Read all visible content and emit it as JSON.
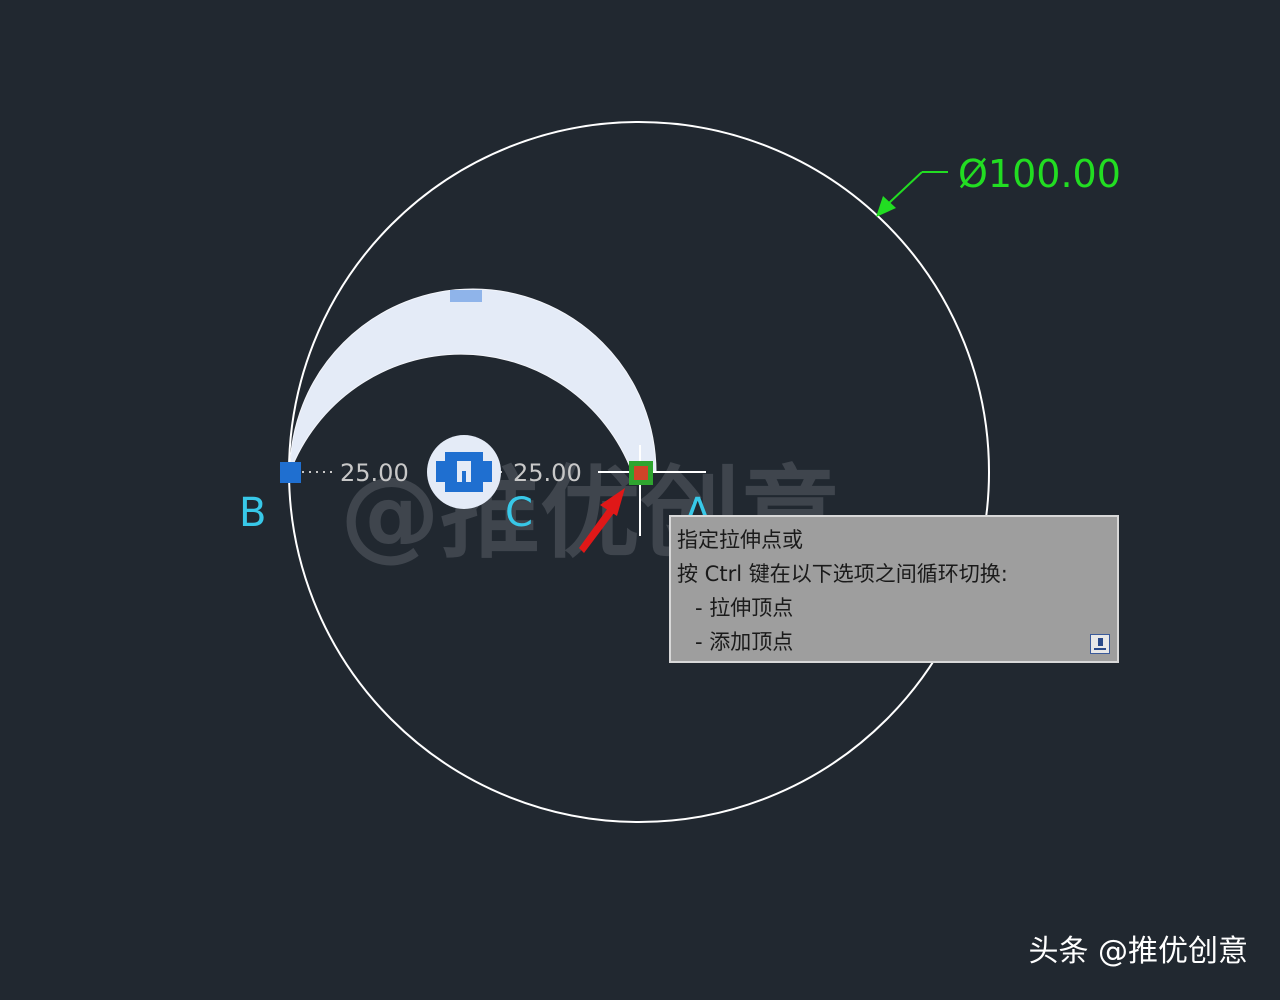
{
  "drawing": {
    "diameter_dimension": "Ø100.00",
    "dimension_left": "25.00",
    "dimension_right": "25.00",
    "point_labels": {
      "a": "A",
      "b": "B",
      "c": "C"
    }
  },
  "tooltip": {
    "line1": "指定拉伸点或",
    "line2": "按 Ctrl 键在以下选项之间循环切换:",
    "options": [
      "- 拉伸顶点",
      "- 添加顶点"
    ],
    "expand_icon": "expand-icon"
  },
  "watermark": "@推优创意",
  "credit": "头条 @推优创意",
  "colors": {
    "background": "#212830",
    "circle": "#ffffff",
    "arc_fill": "#e4ebf7",
    "grip": "#1f6fd0",
    "dimension": "#22dd22",
    "point_label": "#38c8e8",
    "arrow": "#e01818",
    "tooltip_bg": "#9e9e9e"
  }
}
